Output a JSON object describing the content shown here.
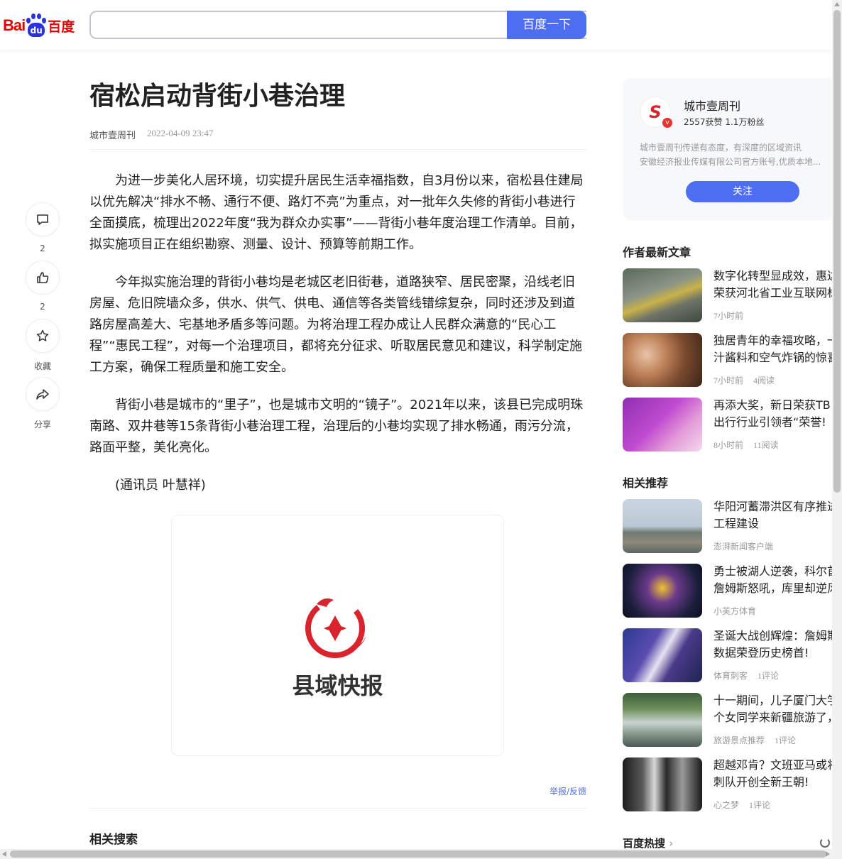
{
  "header": {
    "logo_bai": "Bai",
    "logo_du": "du",
    "logo_baidu_cn": "百度",
    "search_value": "",
    "search_button": "百度一下"
  },
  "article": {
    "title": "宿松启动背街小巷治理",
    "source": "城市壹周刊",
    "time": "2022-04-09 23:47",
    "paragraphs": [
      "为进一步美化人居环境，切实提升居民生活幸福指数，自3月份以来，宿松县住建局以优先解决“排水不畅、通行不便、路灯不亮”为重点，对一批年久失修的背街小巷进行全面摸底，梳理出2022年度“我为群众办实事”——背街小巷年度治理工作清单。目前，拟实施项目正在组织勘察、测量、设计、预算等前期工作。",
      "今年拟实施治理的背街小巷均是老城区老旧街巷，道路狭窄、居民密聚，沿线老旧房屋、危旧院墙众多，供水、供气、供电、通信等各类管线错综复杂，同时还涉及到道路房屋高差大、宅基地矛盾多等问题。为将治理工程办成让人民群众满意的“民心工程”“惠民工程”，对每一个治理项目，都将充分征求、听取居民意见和建议，科学制定施工方案，确保工程质量和施工安全。",
      "背街小巷是城市的“里子”，也是城市文明的“镜子”。2021年以来，该县已完成明珠南路、双井巷等15条背街小巷治理工程，治理后的小巷均实现了排水畅通，雨污分流，路面平整，美化亮化。",
      "(通讯员 叶慧祥)"
    ],
    "figure_caption": "县域快报",
    "report": "举报/反馈",
    "related_search": "相关搜索"
  },
  "tools": {
    "comment_count": "2",
    "like_count": "2",
    "collect": "收藏",
    "share": "分享"
  },
  "author": {
    "logo_letter": "S",
    "verified": "v",
    "name": "城市壹周刊",
    "stats": "2557获赞 1.1万粉丝",
    "desc_1": "城市壹周刊传递有态度，有深度的区域资讯",
    "desc_2": "安徽经济报业传媒有限公司官方账号,优质本地...",
    "follow": "关注"
  },
  "latest": {
    "title": "作者最新文章",
    "items": [
      {
        "title_1": "数字化转型显成效，惠达",
        "title_2": "荣获河北省工业互联网标",
        "meta_1": "7小时前",
        "meta_2": ""
      },
      {
        "title_1": "独居青年的幸福攻略，一",
        "title_2": "汁酱料和空气炸锅的惊喜",
        "meta_1": "7小时前",
        "meta_2": "4阅读"
      },
      {
        "title_1": "再添大奖，新日荣获TB",
        "title_2": "出行行业引领者“荣誉!",
        "meta_1": "8小时前",
        "meta_2": "11阅读"
      }
    ]
  },
  "recommend": {
    "title": "相关推荐",
    "items": [
      {
        "title_1": "华阳河蓄滞洪区有序推进",
        "title_2": "工程建设",
        "meta_1": "澎湃新闻客户端",
        "meta_2": ""
      },
      {
        "title_1": "勇士被湖人逆袭，科尔首",
        "title_2": "詹姆斯怒吼，库里却逆风",
        "meta_1": "小芙方体育",
        "meta_2": ""
      },
      {
        "title_1": "圣诞大战创辉煌：詹姆斯",
        "title_2": "数据荣登历史榜首!",
        "meta_1": "体育刺客",
        "meta_2": "1评论"
      },
      {
        "title_1": "十一期间，儿子厦门大学",
        "title_2": "个女同学来新疆旅游了，",
        "meta_1": "旅游景点推荐",
        "meta_2": "1评论"
      },
      {
        "title_1": "超越邓肯？文班亚马或将",
        "title_2": "刺队开创全新王朝!",
        "meta_1": "心之梦",
        "meta_2": "1评论"
      }
    ]
  },
  "hot": {
    "title": "百度热搜"
  },
  "colors": {
    "accent": "#4e6ef2",
    "brand_red": "#e10601",
    "brand_blue": "#2932e1"
  }
}
